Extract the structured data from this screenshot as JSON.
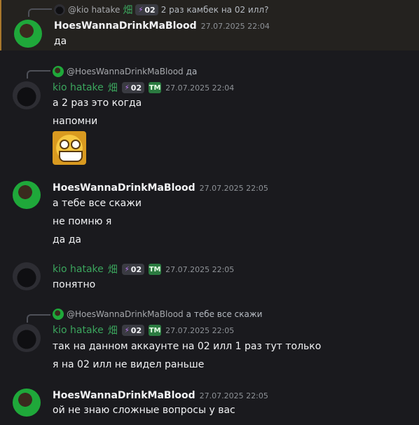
{
  "messages": [
    {
      "reply": {
        "author": "@kio hatake",
        "kanji": "畑",
        "tag": "02",
        "text": "2 раз камбек на 02 илл?"
      },
      "author": "HoesWannaDrinkMaBlood",
      "time": "27.07.2025 22:04",
      "lines": [
        "да"
      ]
    },
    {
      "reply": {
        "author": "@HoesWannaDrinkMaBlood",
        "text": "да"
      },
      "author": "kio hatake",
      "kanji": "畑",
      "tag": "02",
      "badge": "TM",
      "time": "27.07.2025 22:04",
      "lines": [
        "а 2 раз это когда",
        "напомни"
      ],
      "emoji": "grin-emoji"
    },
    {
      "author": "HoesWannaDrinkMaBlood",
      "time": "27.07.2025 22:05",
      "lines": [
        "а тебе все скажи",
        "не помню я",
        "да да"
      ]
    },
    {
      "author": "kio hatake",
      "kanji": "畑",
      "tag": "02",
      "badge": "TM",
      "time": "27.07.2025 22:05",
      "lines": [
        "понятно"
      ]
    },
    {
      "reply": {
        "author": "@HoesWannaDrinkMaBlood",
        "text": "а тебе все скажи"
      },
      "author": "kio hatake",
      "kanji": "畑",
      "tag": "02",
      "badge": "TM",
      "time": "27.07.2025 22:05",
      "lines": [
        "так на данном аккаунте на 02 илл 1 раз тут только",
        "я на 02 илл не видел раньше"
      ]
    },
    {
      "author": "HoesWannaDrinkMaBlood",
      "time": "27.07.2025 22:05",
      "lines": [
        "ой не знаю сложные вопросы у вас"
      ]
    }
  ],
  "colors": {
    "accent_green": "#3ba55d",
    "highlight_bar": "#a8782c",
    "tag_bolt": "#c77dff"
  }
}
